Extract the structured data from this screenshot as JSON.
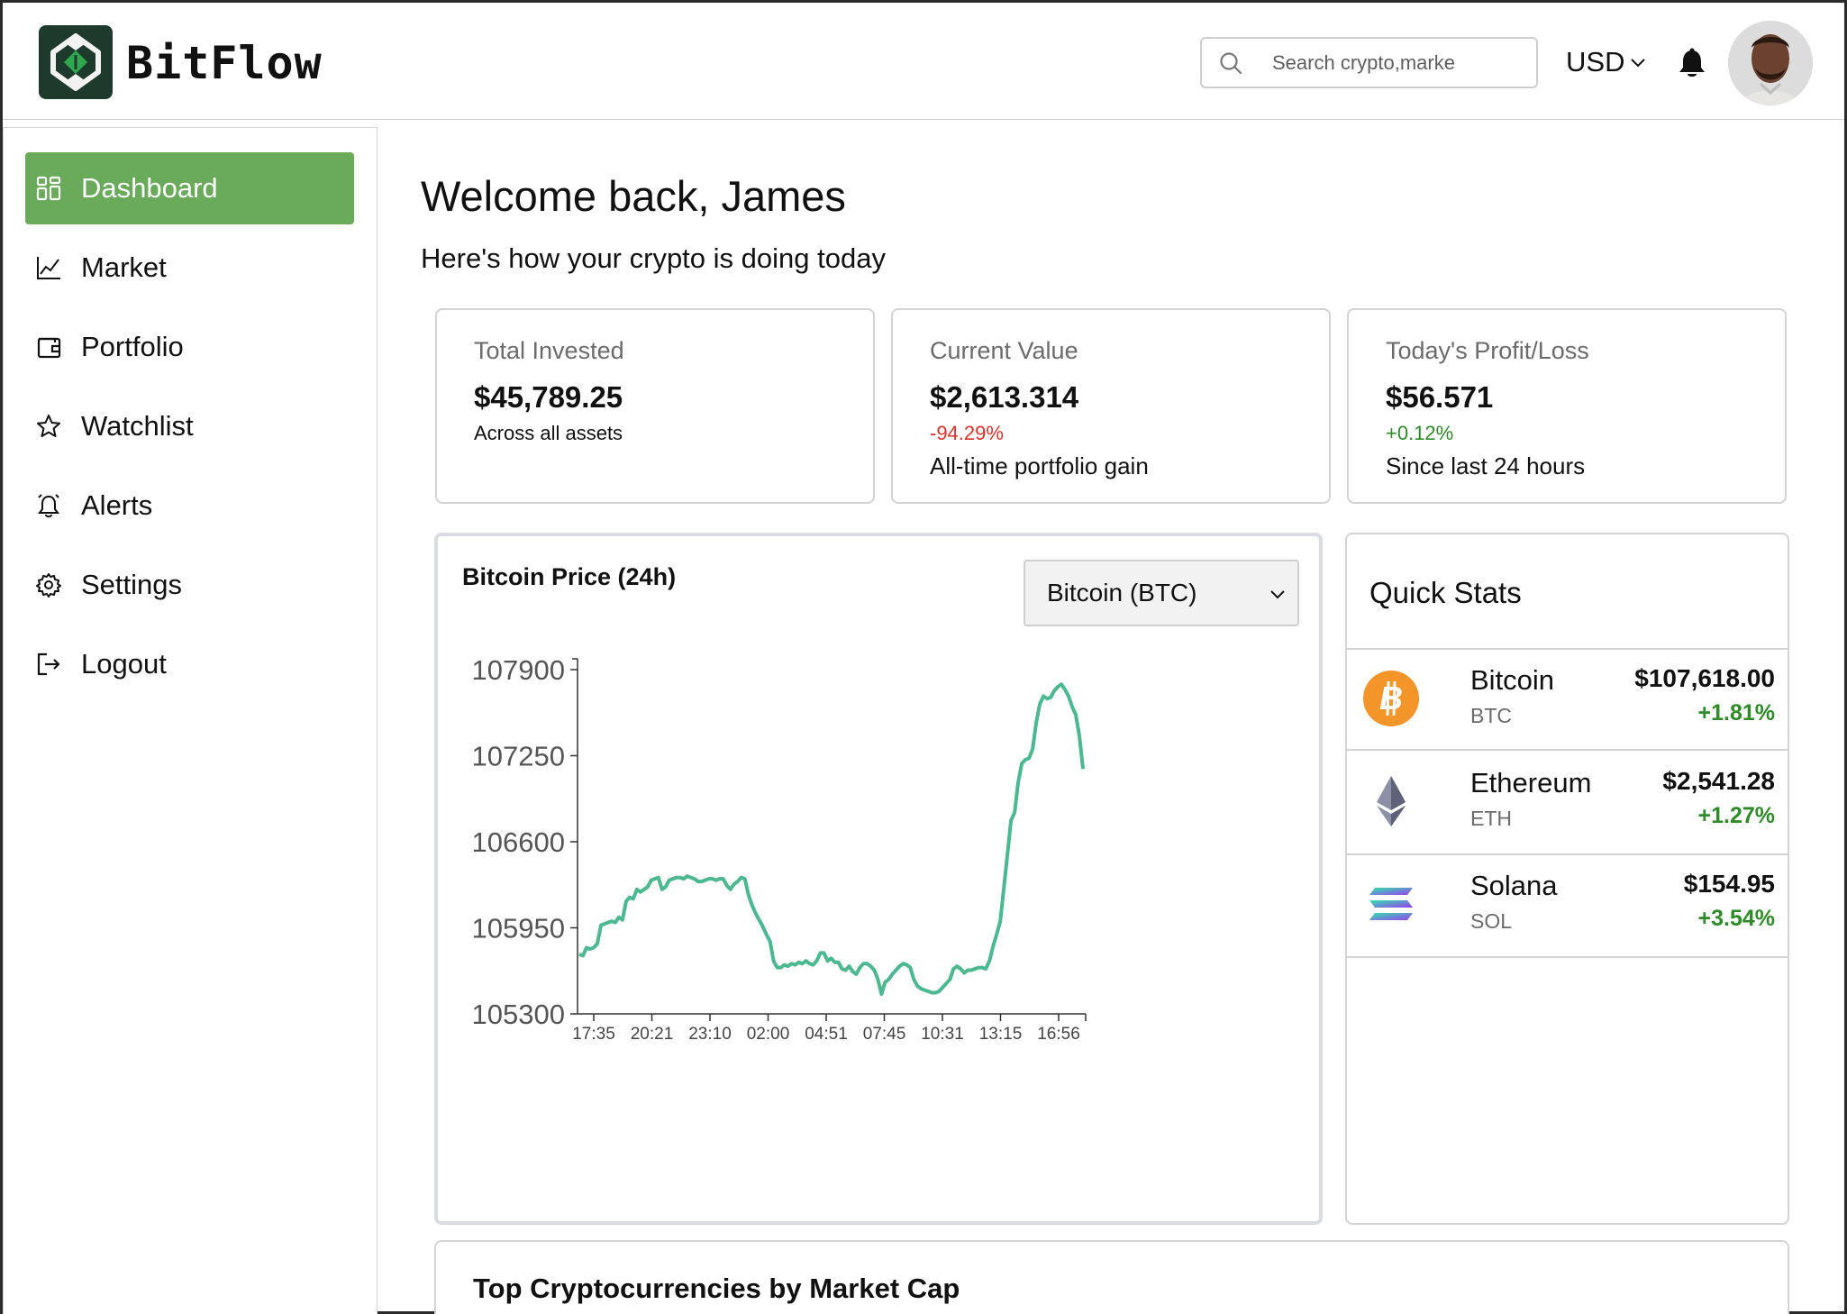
{
  "app": {
    "name": "BitFlow"
  },
  "header": {
    "search_placeholder": "Search crypto,marke",
    "currency": "USD"
  },
  "sidebar": {
    "items": [
      {
        "label": "Dashboard",
        "icon": "dashboard-icon",
        "active": true
      },
      {
        "label": "Market",
        "icon": "chart-line-icon"
      },
      {
        "label": "Portfolio",
        "icon": "wallet-icon"
      },
      {
        "label": "Watchlist",
        "icon": "star-icon"
      },
      {
        "label": "Alerts",
        "icon": "bell-icon"
      },
      {
        "label": "Settings",
        "icon": "gear-icon"
      },
      {
        "label": "Logout",
        "icon": "logout-icon"
      }
    ]
  },
  "main": {
    "welcome": "Welcome back, James",
    "subtitle": "Here's how your crypto is doing today",
    "cards": [
      {
        "label": "Total Invested",
        "value": "$45,789.25",
        "pct": "",
        "note": "Across all assets"
      },
      {
        "label": "Current Value",
        "value": "$2,613.314",
        "pct": "-94.29%",
        "note": "All-time portfolio gain"
      },
      {
        "label": "Today's Profit/Loss",
        "value": "$56.571",
        "pct": "+0.12%",
        "note": "Since last 24 hours"
      }
    ],
    "chart": {
      "title": "Bitcoin Price (24h)",
      "selected_asset": "Bitcoin (BTC)"
    },
    "quick_stats": {
      "title": "Quick Stats",
      "coins": [
        {
          "name": "Bitcoin",
          "symbol": "BTC",
          "price": "$107,618.00",
          "change": "+1.81%",
          "icon": "bitcoin-icon"
        },
        {
          "name": "Ethereum",
          "symbol": "ETH",
          "price": "$2,541.28",
          "change": "+1.27%",
          "icon": "ethereum-icon"
        },
        {
          "name": "Solana",
          "symbol": "SOL",
          "price": "$154.95",
          "change": "+3.54%",
          "icon": "solana-icon"
        }
      ]
    },
    "top_crypto_title": "Top Cryptocurrencies by Market Cap"
  },
  "colors": {
    "accent": "#6aaa5b",
    "line": "#4cb890",
    "negative": "#e0312b",
    "positive": "#2e8b28"
  },
  "chart_data": {
    "type": "line",
    "yticks": [
      105300,
      105950,
      106600,
      107250,
      107900
    ],
    "ylim": [
      105300,
      107900
    ],
    "xticks": [
      "17:35",
      "20:21",
      "23:10",
      "02:00",
      "04:51",
      "07:45",
      "10:31",
      "13:15",
      "16:56"
    ],
    "series": [
      {
        "values": [
          105750,
          105740,
          105800,
          105790,
          105800,
          105830,
          105970,
          105980,
          105990,
          106000,
          105990,
          106030,
          106010,
          106150,
          106180,
          106170,
          106240,
          106220,
          106240,
          106260,
          106310,
          106320,
          106330,
          106240,
          106260,
          106310,
          106320,
          106330,
          106330,
          106320,
          106340,
          106330,
          106320,
          106300,
          106300,
          106310,
          106320,
          106320,
          106310,
          106320,
          106320,
          106270,
          106240,
          106280,
          106300,
          106330,
          106320,
          106200,
          106120,
          106060,
          106010,
          105960,
          105900,
          105850,
          105700,
          105650,
          105650,
          105670,
          105660,
          105680,
          105670,
          105690,
          105680,
          105700,
          105680,
          105670,
          105700,
          105760,
          105760,
          105700,
          105720,
          105690,
          105690,
          105640,
          105630,
          105660,
          105620,
          105600,
          105650,
          105680,
          105680,
          105660,
          105630,
          105560,
          105450,
          105540,
          105560,
          105600,
          105630,
          105660,
          105680,
          105670,
          105650,
          105560,
          105510,
          105490,
          105480,
          105470,
          105460,
          105460,
          105470,
          105500,
          105530,
          105560,
          105640,
          105660,
          105640,
          105610,
          105630,
          105630,
          105640,
          105650,
          105650,
          105640,
          105700,
          105810,
          105900,
          106000,
          106250,
          106500,
          106760,
          106820,
          107050,
          107190,
          107220,
          107230,
          107300,
          107500,
          107640,
          107700,
          107680,
          107690,
          107740,
          107770,
          107790,
          107750,
          107700,
          107620,
          107560,
          107400,
          107150
        ]
      }
    ]
  }
}
